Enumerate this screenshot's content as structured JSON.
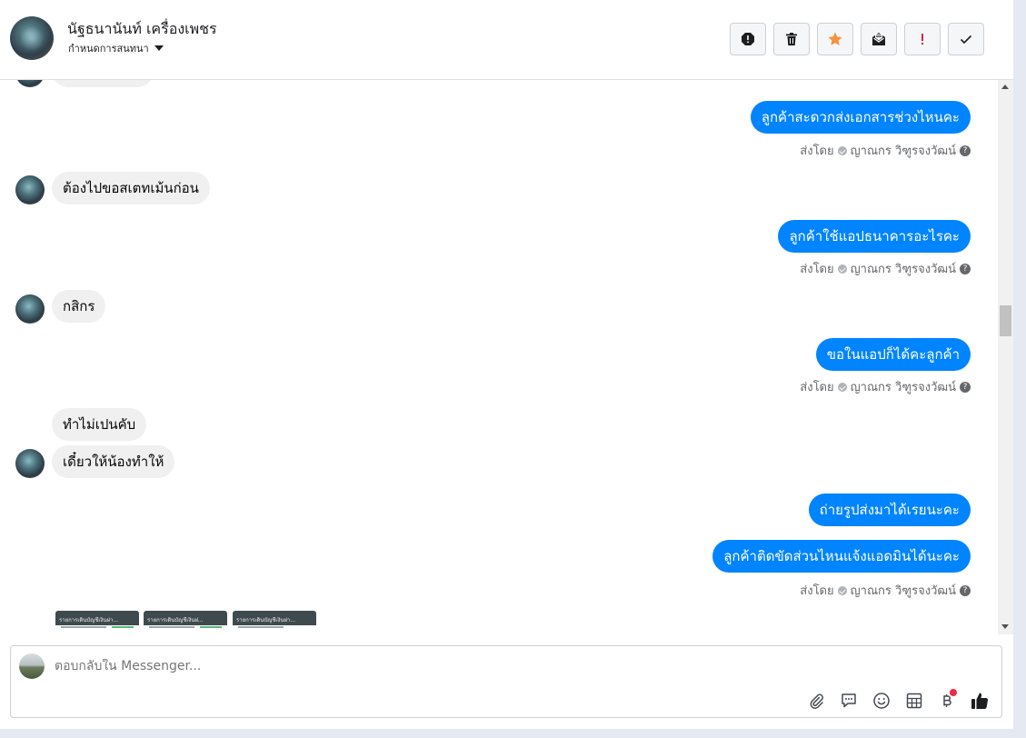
{
  "header": {
    "contact_name": "นัฐธนานันท์ เครื่องเพชร",
    "conversation_label": "กำหนดการสนทนา",
    "toolbar": [
      {
        "name": "report-spam-icon",
        "color": "#1c1e21"
      },
      {
        "name": "trash-icon",
        "color": "#1c1e21"
      },
      {
        "name": "star-icon",
        "color": "#f7923b"
      },
      {
        "name": "mark-unread-icon",
        "color": "#1c1e21"
      },
      {
        "name": "important-icon",
        "color": "#e41e3f"
      },
      {
        "name": "check-icon",
        "color": "#1c1e21"
      }
    ]
  },
  "messages": {
    "m1": "ลูกค้าสะดวกส่งเอกสารช่วงไหนคะ",
    "m2": "ต้องไปขอสเตทเม้นก่อน",
    "m3": "ลูกค้าใช้แอปธนาคารอะไรคะ",
    "m4": "กสิกร",
    "m5": "ขอในแอปก็ได้คะลูกค้า",
    "m6": "ทำไม่เปนคับ",
    "m7": "เดี๋ยวให้น้องทำให้",
    "m8": "ถ่ายรูปส่งมาได้เรยนะคะ",
    "m9": "ลูกค้าติดขัดส่วนไหนแจ้งแอดมินได้นะคะ"
  },
  "sent_by": {
    "prefix": "ส่งโดย",
    "agent": "ญาณกร วิฑูรจงวัฒน์",
    "help": "?"
  },
  "attachments": [
    {
      "caption": "รายการเดินบัญชีเงินฝา..."
    },
    {
      "caption": "รายการเดินบัญชีเงินฝ..."
    },
    {
      "caption": "รายการเดินบัญชีเงินฝา..."
    }
  ],
  "composer": {
    "placeholder": "ตอบกลับใน Messenger...",
    "icons": [
      "attach-icon",
      "saved-replies-icon",
      "emoji-icon",
      "table-icon",
      "baht-payment-icon",
      "thumbs-up-icon"
    ]
  },
  "colors": {
    "outgoing_bubble": "#0084ff",
    "incoming_bubble": "#f0f0f0",
    "star": "#f7923b",
    "important": "#e41e3f"
  }
}
